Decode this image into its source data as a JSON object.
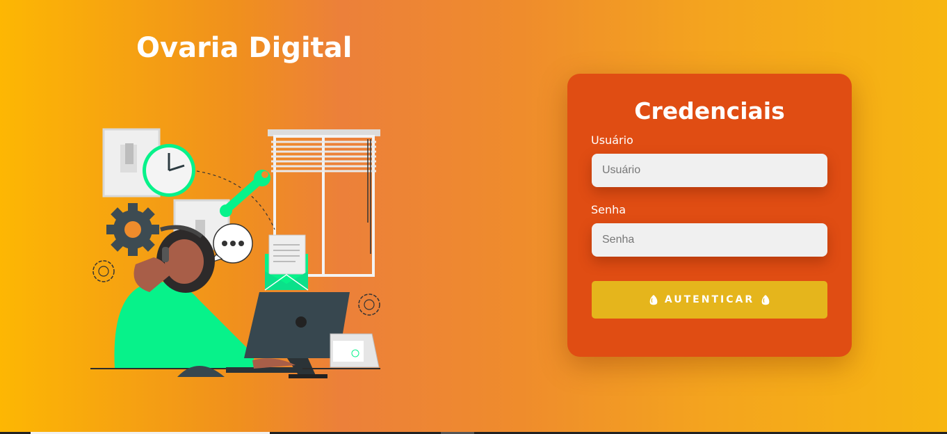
{
  "header": {
    "brand": "Ovaria Digital"
  },
  "illustration": {
    "name": "support-agent-illustration"
  },
  "login_card": {
    "title": "Credenciais",
    "username_label": "Usuário",
    "username_placeholder": "Usuário",
    "username_value": "",
    "password_label": "Senha",
    "password_placeholder": "Senha",
    "password_value": "",
    "submit_label": "AUTENTICAR",
    "submit_icon": "egg-icon"
  },
  "colors": {
    "card": "#e04d13",
    "button": "#e5b51c",
    "accent_green": "#07f28a"
  }
}
